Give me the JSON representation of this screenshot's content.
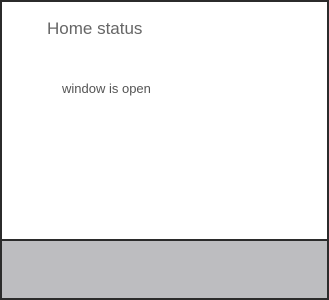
{
  "window": {
    "title": "Home status"
  },
  "main": {
    "status_text": "window is open"
  }
}
